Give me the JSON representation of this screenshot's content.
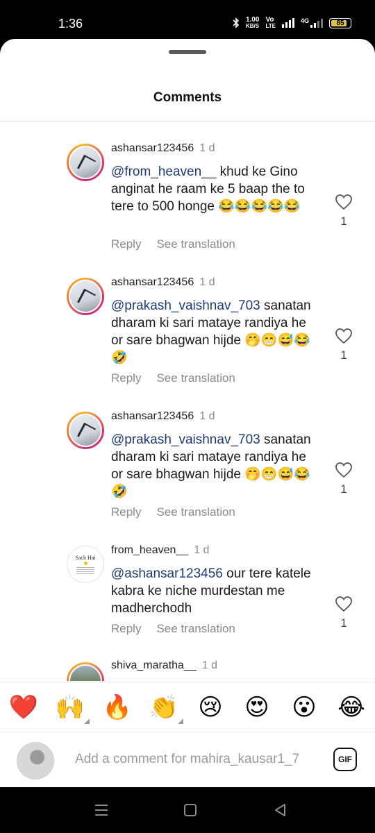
{
  "status_bar": {
    "time": "1:36",
    "net_speed": "1.00",
    "net_unit": "KB/S",
    "volte_top": "Vo",
    "volte_bottom": "LTE",
    "lte2": "4G",
    "battery": "85"
  },
  "sheet": {
    "title": "Comments"
  },
  "comments": [
    {
      "username": "ashansar123456",
      "time": "1 d",
      "mention": "@from_heaven__",
      "text": " khud ke Gino anginat he raam ke 5 baap the to tere to 500 honge 😂😂😂😂😂",
      "reply_label": "Reply",
      "translate_label": "See translation",
      "likes": "1"
    },
    {
      "username": "ashansar123456",
      "time": "1 d",
      "mention": "@prakash_vaishnav_703",
      "text": " sanatan dharam ki sari mataye randiya he or sare bhagwan hijde 🤭😁😅😂🤣",
      "reply_label": "Reply",
      "translate_label": "See translation",
      "likes": "1"
    },
    {
      "username": "ashansar123456",
      "time": "1 d",
      "mention": "@prakash_vaishnav_703",
      "text": " sanatan dharam ki sari mataye randiya he or sare bhagwan hijde 🤭😁😅😂🤣",
      "reply_label": "Reply",
      "translate_label": "See translation",
      "likes": "1"
    },
    {
      "username": "from_heaven__",
      "time": "1 d",
      "mention": "@ashansar123456",
      "text": " our tere katele kabra ke niche murdestan me madherchodh",
      "reply_label": "Reply",
      "translate_label": "See translation",
      "likes": "1",
      "avatar_text": "Sach Hai"
    },
    {
      "username": "shiva_maratha__",
      "time": "1 d"
    }
  ],
  "emoji_bar": [
    "❤️",
    "🙌",
    "🔥",
    "👏",
    "😢",
    "😍",
    "😮",
    "😂"
  ],
  "input": {
    "placeholder": "Add a comment for mahira_kausar1_7",
    "gif_label": "GIF"
  },
  "colors": {
    "mention": "#1e3a73",
    "secondary_text": "#8a8a8a",
    "battery": "#e0c34a"
  }
}
